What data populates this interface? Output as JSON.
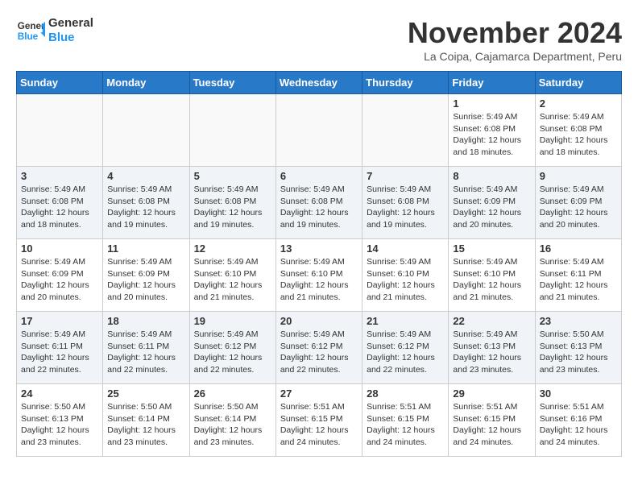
{
  "header": {
    "logo_line1": "General",
    "logo_line2": "Blue",
    "month_title": "November 2024",
    "location": "La Coipa, Cajamarca Department, Peru"
  },
  "days_of_week": [
    "Sunday",
    "Monday",
    "Tuesday",
    "Wednesday",
    "Thursday",
    "Friday",
    "Saturday"
  ],
  "weeks": [
    [
      {
        "day": "",
        "info": ""
      },
      {
        "day": "",
        "info": ""
      },
      {
        "day": "",
        "info": ""
      },
      {
        "day": "",
        "info": ""
      },
      {
        "day": "",
        "info": ""
      },
      {
        "day": "1",
        "info": "Sunrise: 5:49 AM\nSunset: 6:08 PM\nDaylight: 12 hours and 18 minutes."
      },
      {
        "day": "2",
        "info": "Sunrise: 5:49 AM\nSunset: 6:08 PM\nDaylight: 12 hours and 18 minutes."
      }
    ],
    [
      {
        "day": "3",
        "info": "Sunrise: 5:49 AM\nSunset: 6:08 PM\nDaylight: 12 hours and 18 minutes."
      },
      {
        "day": "4",
        "info": "Sunrise: 5:49 AM\nSunset: 6:08 PM\nDaylight: 12 hours and 19 minutes."
      },
      {
        "day": "5",
        "info": "Sunrise: 5:49 AM\nSunset: 6:08 PM\nDaylight: 12 hours and 19 minutes."
      },
      {
        "day": "6",
        "info": "Sunrise: 5:49 AM\nSunset: 6:08 PM\nDaylight: 12 hours and 19 minutes."
      },
      {
        "day": "7",
        "info": "Sunrise: 5:49 AM\nSunset: 6:08 PM\nDaylight: 12 hours and 19 minutes."
      },
      {
        "day": "8",
        "info": "Sunrise: 5:49 AM\nSunset: 6:09 PM\nDaylight: 12 hours and 20 minutes."
      },
      {
        "day": "9",
        "info": "Sunrise: 5:49 AM\nSunset: 6:09 PM\nDaylight: 12 hours and 20 minutes."
      }
    ],
    [
      {
        "day": "10",
        "info": "Sunrise: 5:49 AM\nSunset: 6:09 PM\nDaylight: 12 hours and 20 minutes."
      },
      {
        "day": "11",
        "info": "Sunrise: 5:49 AM\nSunset: 6:09 PM\nDaylight: 12 hours and 20 minutes."
      },
      {
        "day": "12",
        "info": "Sunrise: 5:49 AM\nSunset: 6:10 PM\nDaylight: 12 hours and 21 minutes."
      },
      {
        "day": "13",
        "info": "Sunrise: 5:49 AM\nSunset: 6:10 PM\nDaylight: 12 hours and 21 minutes."
      },
      {
        "day": "14",
        "info": "Sunrise: 5:49 AM\nSunset: 6:10 PM\nDaylight: 12 hours and 21 minutes."
      },
      {
        "day": "15",
        "info": "Sunrise: 5:49 AM\nSunset: 6:10 PM\nDaylight: 12 hours and 21 minutes."
      },
      {
        "day": "16",
        "info": "Sunrise: 5:49 AM\nSunset: 6:11 PM\nDaylight: 12 hours and 21 minutes."
      }
    ],
    [
      {
        "day": "17",
        "info": "Sunrise: 5:49 AM\nSunset: 6:11 PM\nDaylight: 12 hours and 22 minutes."
      },
      {
        "day": "18",
        "info": "Sunrise: 5:49 AM\nSunset: 6:11 PM\nDaylight: 12 hours and 22 minutes."
      },
      {
        "day": "19",
        "info": "Sunrise: 5:49 AM\nSunset: 6:12 PM\nDaylight: 12 hours and 22 minutes."
      },
      {
        "day": "20",
        "info": "Sunrise: 5:49 AM\nSunset: 6:12 PM\nDaylight: 12 hours and 22 minutes."
      },
      {
        "day": "21",
        "info": "Sunrise: 5:49 AM\nSunset: 6:12 PM\nDaylight: 12 hours and 22 minutes."
      },
      {
        "day": "22",
        "info": "Sunrise: 5:49 AM\nSunset: 6:13 PM\nDaylight: 12 hours and 23 minutes."
      },
      {
        "day": "23",
        "info": "Sunrise: 5:50 AM\nSunset: 6:13 PM\nDaylight: 12 hours and 23 minutes."
      }
    ],
    [
      {
        "day": "24",
        "info": "Sunrise: 5:50 AM\nSunset: 6:13 PM\nDaylight: 12 hours and 23 minutes."
      },
      {
        "day": "25",
        "info": "Sunrise: 5:50 AM\nSunset: 6:14 PM\nDaylight: 12 hours and 23 minutes."
      },
      {
        "day": "26",
        "info": "Sunrise: 5:50 AM\nSunset: 6:14 PM\nDaylight: 12 hours and 23 minutes."
      },
      {
        "day": "27",
        "info": "Sunrise: 5:51 AM\nSunset: 6:15 PM\nDaylight: 12 hours and 24 minutes."
      },
      {
        "day": "28",
        "info": "Sunrise: 5:51 AM\nSunset: 6:15 PM\nDaylight: 12 hours and 24 minutes."
      },
      {
        "day": "29",
        "info": "Sunrise: 5:51 AM\nSunset: 6:15 PM\nDaylight: 12 hours and 24 minutes."
      },
      {
        "day": "30",
        "info": "Sunrise: 5:51 AM\nSunset: 6:16 PM\nDaylight: 12 hours and 24 minutes."
      }
    ]
  ]
}
